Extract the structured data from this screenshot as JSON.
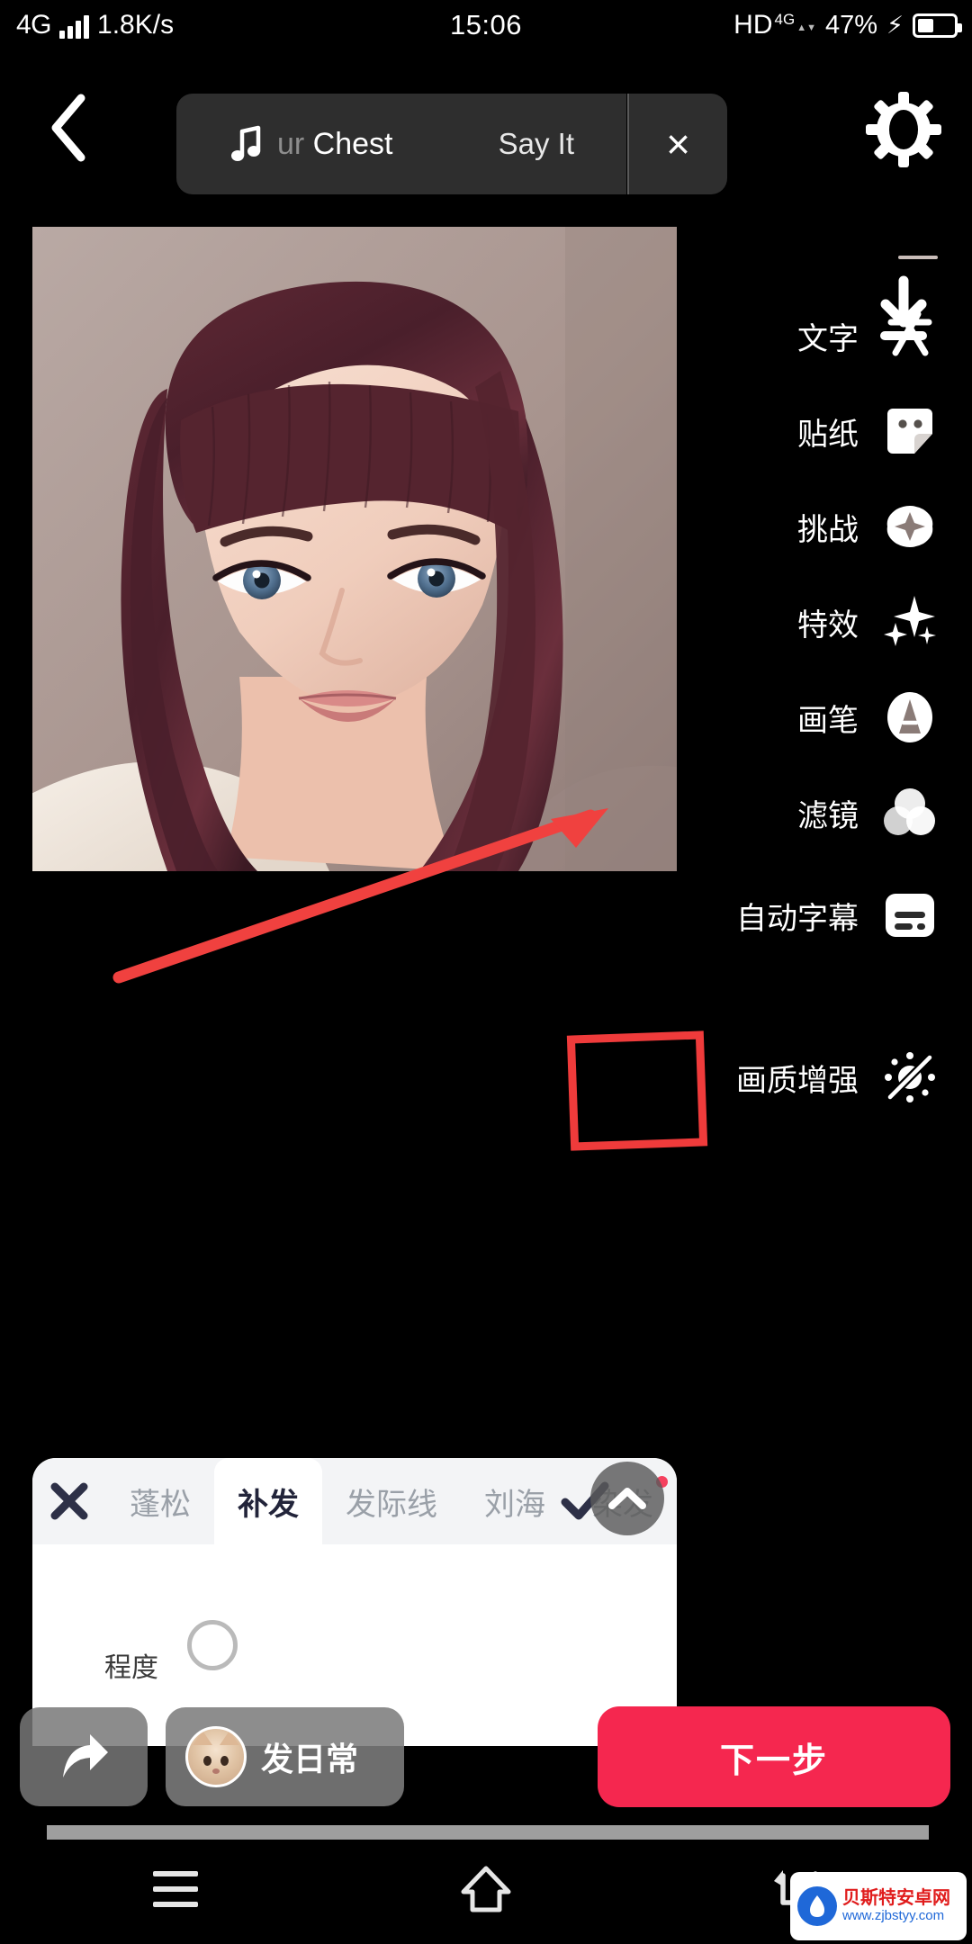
{
  "status_bar": {
    "network_type": "4G",
    "speed": "1.8K/s",
    "time": "15:06",
    "hd": "HD",
    "hd_sup": "4G",
    "battery_percent": "47%"
  },
  "top_bar": {
    "back_icon": "chevron-left-icon",
    "settings_icon": "gear-icon",
    "download_icon": "download-icon",
    "music": {
      "icon": "music-note-icon",
      "title_faded": "ur",
      "title": " Chest",
      "subtitle": "Say It",
      "close_label": "×"
    }
  },
  "tool_rail": {
    "items": [
      {
        "label": "文字",
        "icon": "text-icon"
      },
      {
        "label": "贴纸",
        "icon": "sticker-icon"
      },
      {
        "label": "挑战",
        "icon": "challenge-icon"
      },
      {
        "label": "特效",
        "icon": "sparkle-effects-icon"
      },
      {
        "label": "画笔",
        "icon": "brush-icon"
      },
      {
        "label": "滤镜",
        "icon": "filter-circles-icon"
      },
      {
        "label": "自动字幕",
        "icon": "auto-subtitle-icon"
      },
      {
        "label": "画质增强",
        "icon": "quality-enhance-off-icon"
      }
    ]
  },
  "bottom_sheet": {
    "close_icon": "close-icon",
    "tabs": [
      {
        "label": "蓬松",
        "active": false
      },
      {
        "label": "补发",
        "active": true
      },
      {
        "label": "发际线",
        "active": false
      },
      {
        "label": "刘海",
        "active": false
      },
      {
        "label": "染发",
        "active": false
      }
    ],
    "confirm_icon": "check-icon",
    "collapse_icon": "chevron-up-icon",
    "degree_label": "程度"
  },
  "action_bar": {
    "share_icon": "share-arrow-icon",
    "post_daily_label": "发日常",
    "avatar": "cat-avatar",
    "next_label": "下一步"
  },
  "nav_bar": {
    "recents_icon": "recents-menu-icon",
    "home_icon": "home-icon",
    "back_icon": "back-arrow-icon"
  },
  "watermark": {
    "name": "贝斯特安卓网",
    "url": "www.zjbstyy.com",
    "logo_icon": "shield-drop-icon"
  },
  "annotations": {
    "arrow_color": "#f0413f",
    "box_color": "#ef3b3b",
    "arrow_target": "滤镜",
    "box_target": "check-icon"
  },
  "colors": {
    "accent_red": "#f5274f",
    "sheet_tab_bg": "#f3f4f6",
    "sheet_bg": "#ffffff",
    "pill_bg": "#2e2e2e"
  }
}
